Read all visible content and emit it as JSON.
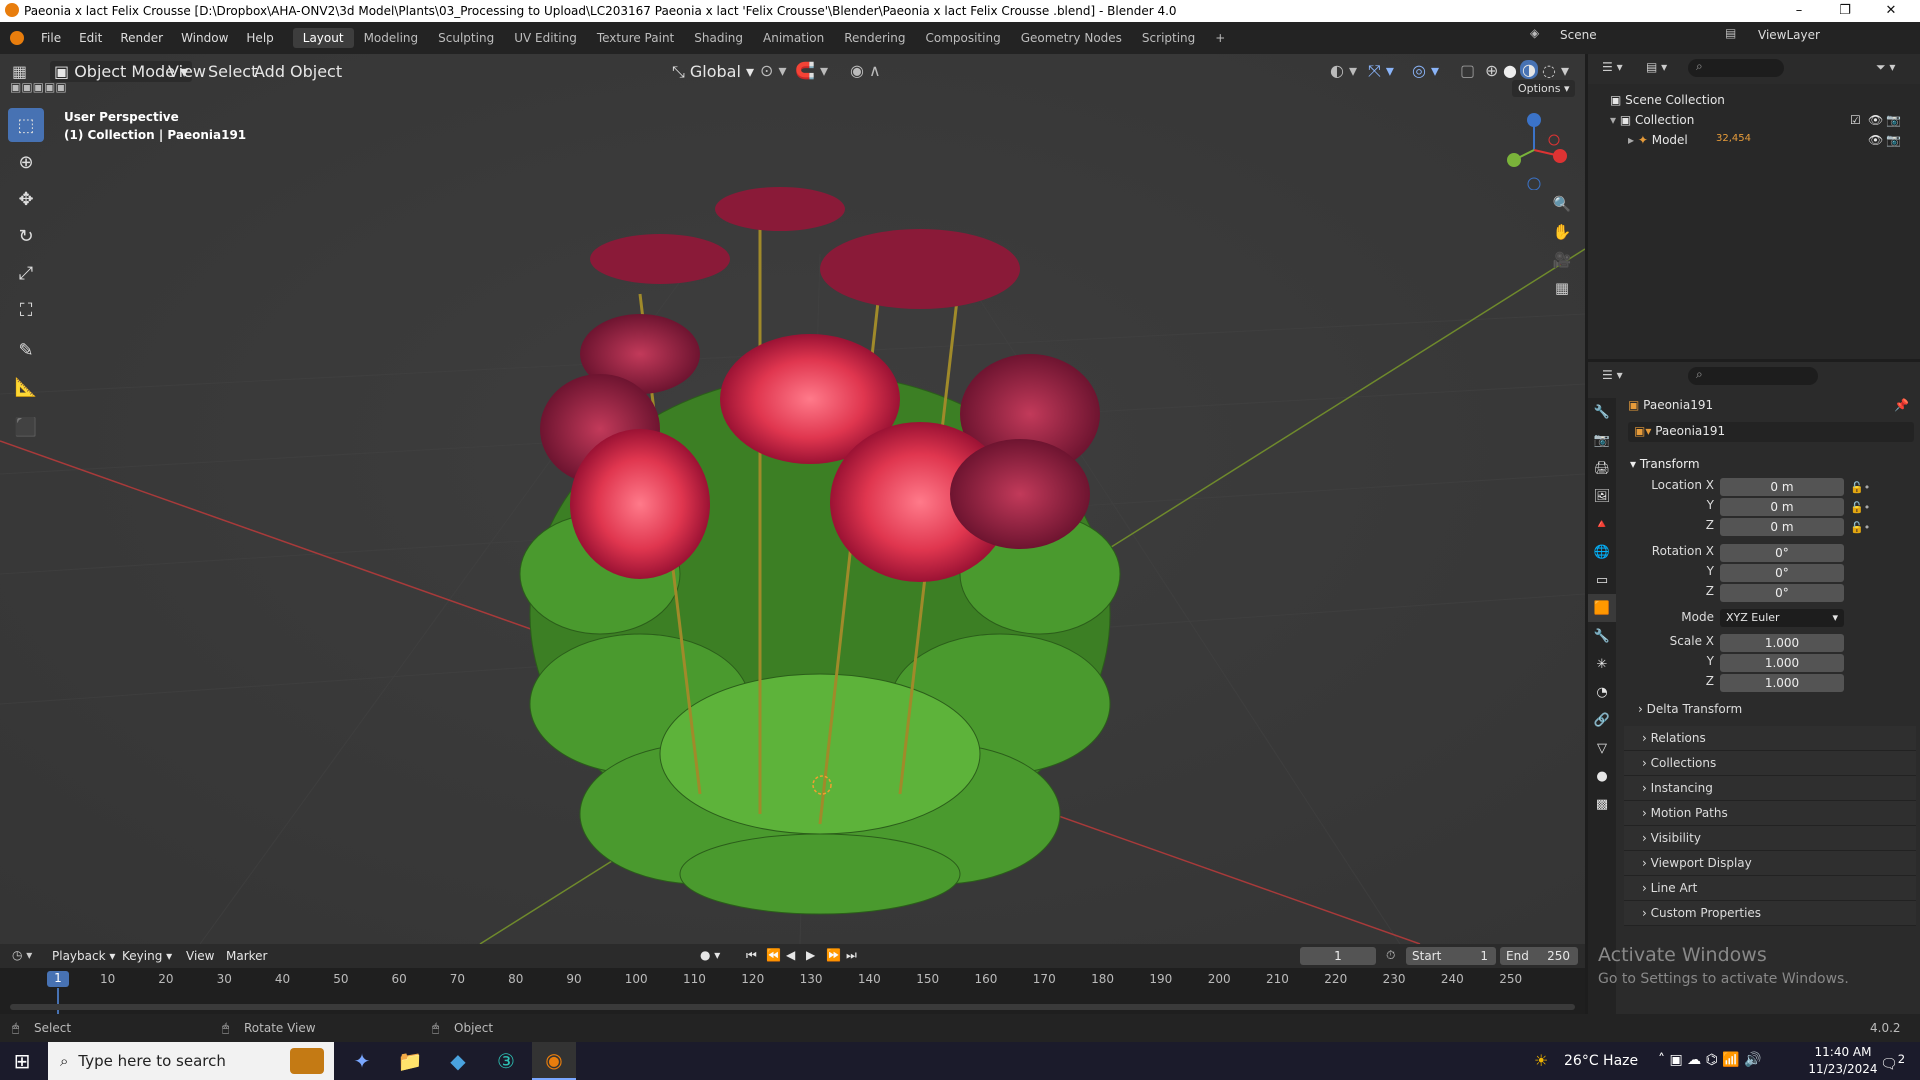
{
  "window": {
    "title": "Paeonia x lact  Felix Crousse  [D:\\Dropbox\\AHA-ONV2\\3d Model\\Plants\\03_Processing to Upload\\LC203167 Paeonia x lact 'Felix Crousse'\\Blender\\Paeonia x lact  Felix Crousse .blend] - Blender 4.0",
    "minimize": "–",
    "maximize": "❐",
    "close": "✕"
  },
  "menu": [
    "File",
    "Edit",
    "Render",
    "Window",
    "Help"
  ],
  "workspaces": [
    "Layout",
    "Modeling",
    "Sculpting",
    "UV Editing",
    "Texture Paint",
    "Shading",
    "Animation",
    "Rendering",
    "Compositing",
    "Geometry Nodes",
    "Scripting"
  ],
  "workspace_add": "+",
  "scene": {
    "label": "Scene",
    "viewlayer": "ViewLayer"
  },
  "viewport_header": {
    "mode": "Object Mode",
    "view": "View",
    "select": "Select",
    "add": "Add",
    "object": "Object",
    "orientation": "Global",
    "options": "Options"
  },
  "viewport": {
    "overlay_line1": "User Perspective",
    "overlay_line2": "(1) Collection | Paeonia191",
    "gizmo": {
      "x": "X",
      "y": "Y",
      "z": "Z"
    }
  },
  "outliner": {
    "scene_collection": "Scene Collection",
    "collection": "Collection",
    "model": "Model",
    "model_badge": "32,454"
  },
  "properties": {
    "object_name": "Paeonia191",
    "datablock": "Paeonia191",
    "transform": "Transform",
    "location_x_label": "Location X",
    "location_x": "0 m",
    "location_y_label": "Y",
    "location_y": "0 m",
    "location_z_label": "Z",
    "location_z": "0 m",
    "rotation_x_label": "Rotation X",
    "rotation_x": "0°",
    "rotation_y_label": "Y",
    "rotation_y": "0°",
    "rotation_z_label": "Z",
    "rotation_z": "0°",
    "mode_label": "Mode",
    "mode": "XYZ Euler",
    "scale_x_label": "Scale X",
    "scale_x": "1.000",
    "scale_y_label": "Y",
    "scale_y": "1.000",
    "scale_z_label": "Z",
    "scale_z": "1.000",
    "delta_transform": "Delta Transform",
    "panels": [
      "Relations",
      "Collections",
      "Instancing",
      "Motion Paths",
      "Visibility",
      "Viewport Display",
      "Line Art",
      "Custom Properties"
    ]
  },
  "timeline": {
    "playback": "Playback",
    "keying": "Keying",
    "view": "View",
    "marker": "Marker",
    "current_frame": "1",
    "start_label": "Start",
    "start": "1",
    "end_label": "End",
    "end": "250",
    "cursor_frame": "1",
    "ticks": [
      "10",
      "20",
      "30",
      "40",
      "50",
      "60",
      "70",
      "80",
      "90",
      "100",
      "110",
      "120",
      "130",
      "140",
      "150",
      "160",
      "170",
      "180",
      "190",
      "200",
      "210",
      "220",
      "230",
      "240",
      "250"
    ]
  },
  "activation": {
    "line1": "Activate Windows",
    "line2": "Go to Settings to activate Windows."
  },
  "status": {
    "select": "Select",
    "rotate_view": "Rotate View",
    "object": "Object",
    "version": "4.0.2"
  },
  "taskbar": {
    "search_placeholder": "Type here to search",
    "weather": "26°C  Haze",
    "time": "11:40 AM",
    "date": "11/23/2024",
    "notifications": "2"
  }
}
